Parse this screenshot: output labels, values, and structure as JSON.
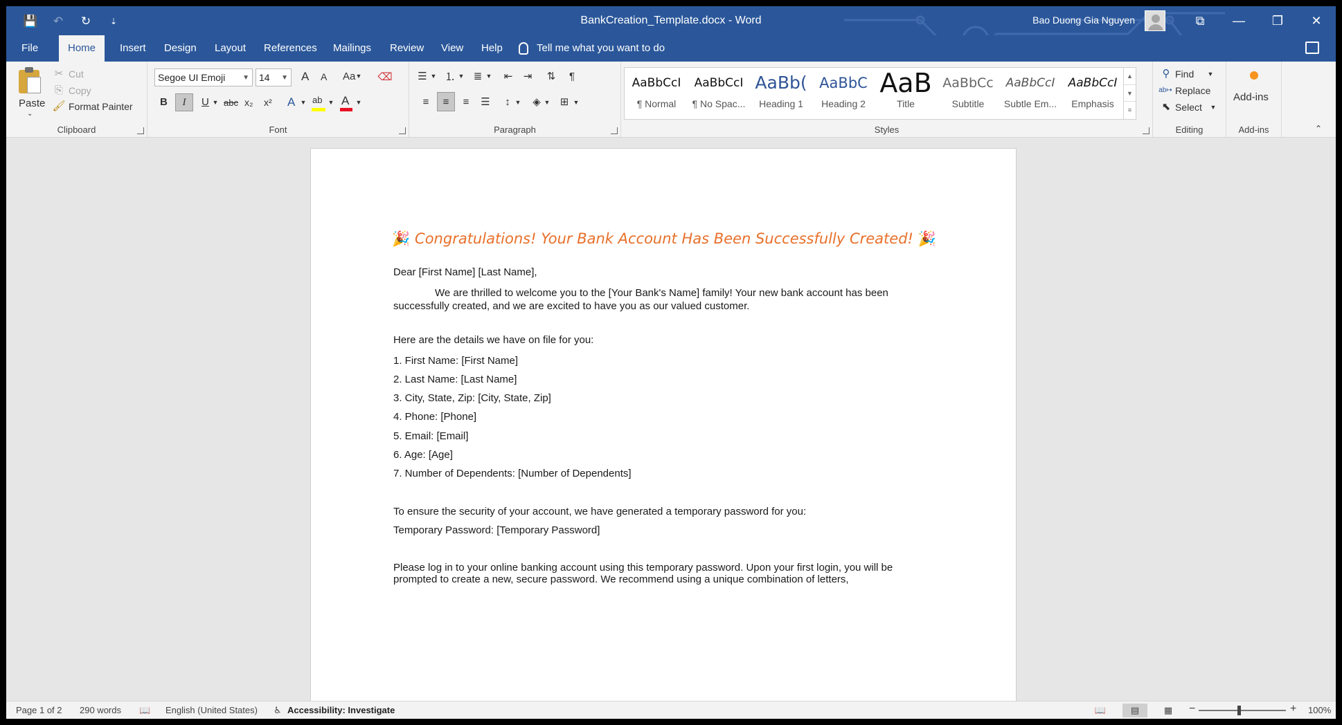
{
  "window": {
    "title": "BankCreation_Template.docx  -  Word",
    "user": "Bao Duong Gia Nguyen"
  },
  "tabs": [
    {
      "label": "File"
    },
    {
      "label": "Home"
    },
    {
      "label": "Insert"
    },
    {
      "label": "Design"
    },
    {
      "label": "Layout"
    },
    {
      "label": "References"
    },
    {
      "label": "Mailings"
    },
    {
      "label": "Review"
    },
    {
      "label": "View"
    },
    {
      "label": "Help"
    }
  ],
  "tell_me": "Tell me what you want to do",
  "clipboard": {
    "paste": "Paste",
    "cut": "Cut",
    "copy": "Copy",
    "format_painter": "Format Painter",
    "label": "Clipboard"
  },
  "font": {
    "family": "Segoe UI Emoji",
    "size": "14",
    "label": "Font",
    "bold": "B",
    "italic": "I",
    "underline": "U",
    "strike": "abc",
    "sub": "x₂",
    "sup": "x²",
    "case": "Aa",
    "grow": "A",
    "shrink": "A",
    "effects": "A",
    "highlight": "ab",
    "color": "A",
    "font_color_hex": "#e81123",
    "highlight_hex": "#ffff00"
  },
  "paragraph": {
    "label": "Paragraph"
  },
  "styles": {
    "label": "Styles",
    "items": [
      {
        "preview": "AaBbCcI",
        "name": "¶ Normal"
      },
      {
        "preview": "AaBbCcI",
        "name": "¶ No Spac..."
      },
      {
        "preview": "AaBb(",
        "name": "Heading 1"
      },
      {
        "preview": "AaBbC",
        "name": "Heading 2"
      },
      {
        "preview": "AaB",
        "name": "Title"
      },
      {
        "preview": "AaBbCc",
        "name": "Subtitle"
      },
      {
        "preview": "AaBbCcI",
        "name": "Subtle Em..."
      },
      {
        "preview": "AaBbCcI",
        "name": "Emphasis"
      }
    ]
  },
  "editing": {
    "find": "Find",
    "replace": "Replace",
    "select": "Select",
    "label": "Editing"
  },
  "addins": {
    "button": "Add-ins",
    "label": "Add-ins"
  },
  "document": {
    "heading": "Congratulations! Your Bank Account Has Been Successfully Created!",
    "heading_icon": "🎉",
    "salutation": "Dear [First Name] [Last Name],",
    "intro_line1": "We are thrilled to welcome you to the [Your Bank's Name] family! Your new bank account has been",
    "intro_line2": "successfully created, and we are excited to have you as our valued customer.",
    "details_intro": "Here are the details we have on file for you:",
    "details": [
      "1. First Name: [First Name]",
      "2. Last Name: [Last Name]",
      "3. City, State, Zip: [City, State, Zip]",
      "4. Phone: [Phone]",
      "5. Email: [Email]",
      "6. Age: [Age]",
      "7. Number of Dependents: [Number of Dependents]"
    ],
    "security_intro": "To ensure the security of your account, we have generated a temporary password for you:",
    "temp_password": "Temporary Password: [Temporary Password]",
    "login_line1": "Please log in to your online banking account using this temporary password. Upon your first login, you will be",
    "login_line2": "prompted to create a new, secure password. We recommend using a unique combination of letters,"
  },
  "status": {
    "page": "Page 1 of 2",
    "words": "290 words",
    "language": "English (United States)",
    "accessibility": "Accessibility: Investigate",
    "zoom": "100%"
  },
  "colors": {
    "brand": "#2b579a",
    "heading": "#e8702a"
  }
}
